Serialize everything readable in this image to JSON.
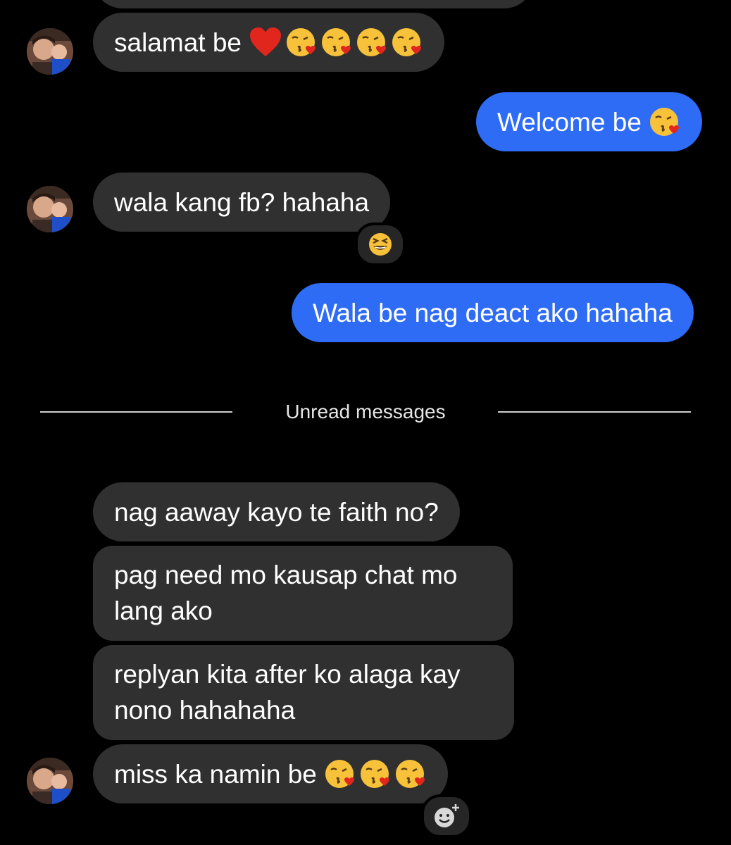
{
  "colors": {
    "background": "#000000",
    "incoming_bubble": "#303030",
    "outgoing_bubble": "#2f6cf6",
    "text": "#ffffff",
    "divider": "#cfcfcf"
  },
  "messages": [
    {
      "direction": "incoming",
      "text": "salamat be",
      "emojis": [
        "red-heart",
        "face-blowing-kiss",
        "face-blowing-kiss",
        "face-blowing-kiss",
        "face-blowing-kiss"
      ],
      "avatar": true
    },
    {
      "direction": "outgoing",
      "text": "Welcome be",
      "emojis": [
        "face-blowing-kiss"
      ]
    },
    {
      "direction": "incoming",
      "text": "wala kang fb? hahaha",
      "avatar": true,
      "reaction": "grinning-squinting-face"
    },
    {
      "direction": "outgoing",
      "text": "Wala be nag deact ako hahaha"
    },
    {
      "direction": "incoming",
      "text": "nag aaway kayo te faith no?"
    },
    {
      "direction": "incoming",
      "lines": [
        "pag need mo kausap chat mo",
        "lang ako"
      ]
    },
    {
      "direction": "incoming",
      "lines": [
        "replyan kita after ko alaga kay",
        "nono hahahaha"
      ]
    },
    {
      "direction": "incoming",
      "text": "miss ka namin be",
      "emojis": [
        "face-blowing-kiss",
        "face-blowing-kiss",
        "face-blowing-kiss"
      ],
      "avatar": true,
      "reaction_button": "add-reaction-icon"
    }
  ],
  "divider": {
    "label": "Unread messages"
  }
}
